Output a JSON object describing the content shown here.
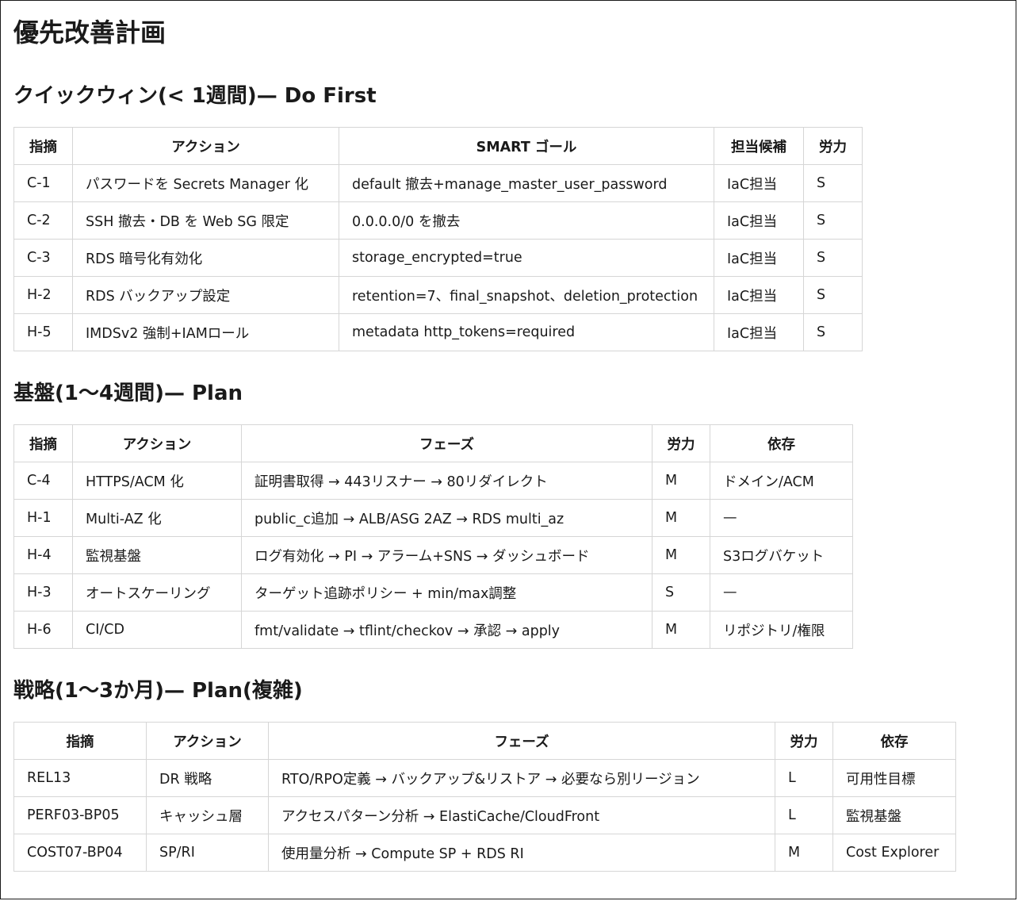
{
  "page": {
    "title": "優先改善計画"
  },
  "sections": [
    {
      "title": "クイックウィン(< 1週間)— Do First",
      "headers": [
        "指摘",
        "アクション",
        "SMART ゴール",
        "担当候補",
        "労力"
      ],
      "rows": [
        [
          "C-1",
          "パスワードを Secrets Manager 化",
          "default 撤去+manage_master_user_password",
          "IaC担当",
          "S"
        ],
        [
          "C-2",
          "SSH 撤去・DB を Web SG 限定",
          "0.0.0.0/0 を撤去",
          "IaC担当",
          "S"
        ],
        [
          "C-3",
          "RDS 暗号化有効化",
          "storage_encrypted=true",
          "IaC担当",
          "S"
        ],
        [
          "H-2",
          "RDS バックアップ設定",
          "retention=7、final_snapshot、deletion_protection",
          "IaC担当",
          "S"
        ],
        [
          "H-5",
          "IMDSv2 強制+IAMロール",
          "metadata http_tokens=required",
          "IaC担当",
          "S"
        ]
      ]
    },
    {
      "title": "基盤(1〜4週間)— Plan",
      "headers": [
        "指摘",
        "アクション",
        "フェーズ",
        "労力",
        "依存"
      ],
      "rows": [
        [
          "C-4",
          "HTTPS/ACM 化",
          "証明書取得 → 443リスナー → 80リダイレクト",
          "M",
          "ドメイン/ACM"
        ],
        [
          "H-1",
          "Multi-AZ 化",
          "public_c追加 → ALB/ASG 2AZ → RDS multi_az",
          "M",
          "—"
        ],
        [
          "H-4",
          "監視基盤",
          "ログ有効化 → PI → アラーム+SNS → ダッシュボード",
          "M",
          "S3ログバケット"
        ],
        [
          "H-3",
          "オートスケーリング",
          "ターゲット追跡ポリシー + min/max調整",
          "S",
          "—"
        ],
        [
          "H-6",
          "CI/CD",
          "fmt/validate → tflint/checkov → 承認 → apply",
          "M",
          "リポジトリ/権限"
        ]
      ]
    },
    {
      "title": "戦略(1〜3か月)— Plan(複雑)",
      "headers": [
        "指摘",
        "アクション",
        "フェーズ",
        "労力",
        "依存"
      ],
      "rows": [
        [
          "REL13",
          "DR 戦略",
          "RTO/RPO定義 → バックアップ&リストア → 必要なら別リージョン",
          "L",
          "可用性目標"
        ],
        [
          "PERF03-BP05",
          "キャッシュ層",
          "アクセスパターン分析 → ElastiCache/CloudFront",
          "L",
          "監視基盤"
        ],
        [
          "COST07-BP04",
          "SP/RI",
          "使用量分析 → Compute SP + RDS RI",
          "M",
          "Cost Explorer"
        ]
      ]
    }
  ]
}
